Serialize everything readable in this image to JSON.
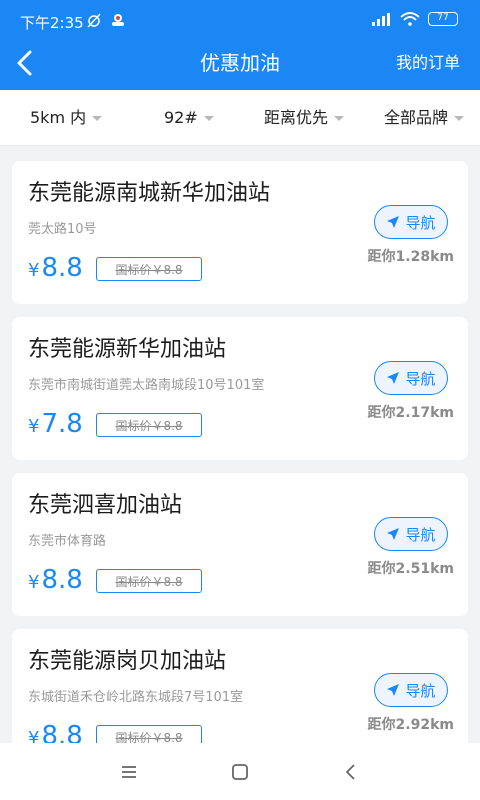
{
  "status_bar": {
    "time": "下午2:35",
    "battery": "77"
  },
  "header": {
    "title": "优惠加油",
    "orders_label": "我的订单"
  },
  "filters": [
    {
      "label": "5km 内"
    },
    {
      "label": "92#"
    },
    {
      "label": "距离优先"
    },
    {
      "label": "全部品牌"
    }
  ],
  "stations": [
    {
      "name": "东莞能源南城新华加油站",
      "address": "莞太路10号",
      "currency": "¥",
      "price": "8.8",
      "list_price": "国标价￥8.8",
      "nav_label": "导航",
      "distance": "距你1.28km"
    },
    {
      "name": "东莞能源新华加油站",
      "address": "东莞市南城街道莞太路南城段10号101室",
      "currency": "¥",
      "price": "7.8",
      "list_price": "国标价￥8.8",
      "nav_label": "导航",
      "distance": "距你2.17km"
    },
    {
      "name": "东莞泗喜加油站",
      "address": "东莞市体育路",
      "currency": "¥",
      "price": "8.8",
      "list_price": "国标价￥8.8",
      "nav_label": "导航",
      "distance": "距你2.51km"
    },
    {
      "name": "东莞能源岗贝加油站",
      "address": "东城街道禾仓岭北路东城段7号101室",
      "currency": "¥",
      "price": "8.8",
      "list_price": "国标价￥8.8",
      "nav_label": "导航",
      "distance": "距你2.92km"
    }
  ],
  "icons": {
    "back": "chevron-left-icon",
    "nav": "navigation-arrow-icon",
    "caret": "caret-down-icon",
    "system_nav": [
      "menu-icon",
      "home-square-icon",
      "back-triangle-icon"
    ]
  },
  "colors": {
    "primary": "#1a87f4",
    "background": "#f2f3f5"
  }
}
